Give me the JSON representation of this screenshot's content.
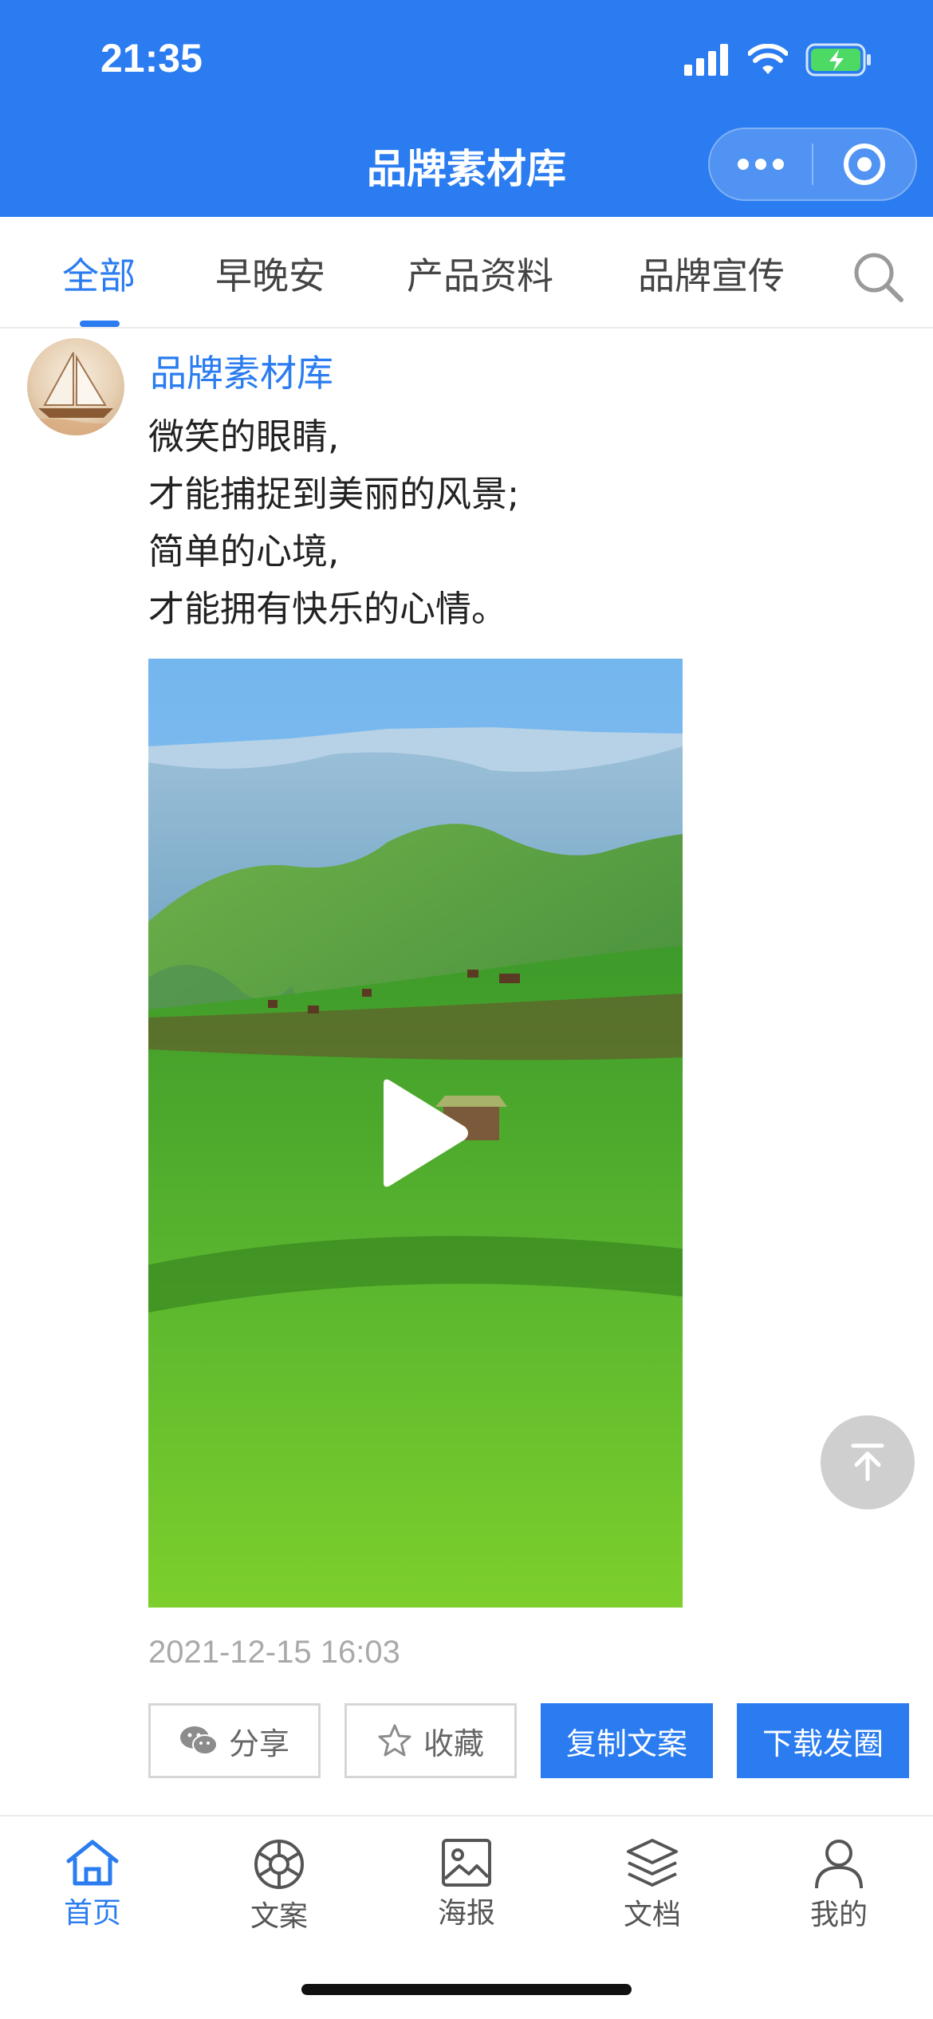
{
  "status_bar": {
    "time": "21:35"
  },
  "nav": {
    "title": "品牌素材库"
  },
  "colors": {
    "brand_blue": "#2a7cf0",
    "text": "#222222",
    "muted": "#a9a9a9",
    "fab_gray": "#cfcfcf"
  },
  "tabs": [
    {
      "label": "全部",
      "active": true
    },
    {
      "label": "早晚安",
      "active": false
    },
    {
      "label": "产品资料",
      "active": false
    },
    {
      "label": "品牌宣传",
      "active": false
    }
  ],
  "post": {
    "author": "品牌素材库",
    "lines": [
      "微笑的眼睛,",
      "才能捕捉到美丽的风景;",
      "简单的心境,",
      "才能拥有快乐的心情。"
    ],
    "timestamp": "2021-12-15 16:03",
    "actions": {
      "share": "分享",
      "favorite": "收藏",
      "copy_text": "复制文案",
      "download_post": "下载发圈"
    }
  },
  "bottom_nav": [
    {
      "label": "首页",
      "icon": "home-icon",
      "active": true
    },
    {
      "label": "文案",
      "icon": "aperture-icon",
      "active": false
    },
    {
      "label": "海报",
      "icon": "image-icon",
      "active": false
    },
    {
      "label": "文档",
      "icon": "layers-icon",
      "active": false
    },
    {
      "label": "我的",
      "icon": "user-icon",
      "active": false
    }
  ]
}
